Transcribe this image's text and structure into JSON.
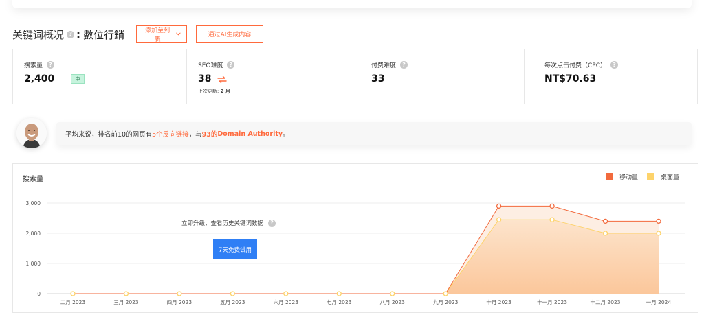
{
  "overview": {
    "title": "关键词概况",
    "separator": ":",
    "keyword": "數位行銷",
    "add_to_list_label": "添加至列表",
    "ai_content_label": "通过AI生成内容"
  },
  "metrics": {
    "search_volume": {
      "label": "搜索量",
      "value": "2,400",
      "badge": "中"
    },
    "seo_difficulty": {
      "label": "SEO难度",
      "value": "38",
      "updated_prefix": "上次更新:",
      "updated_value": "2 月"
    },
    "paid_difficulty": {
      "label": "付费难度",
      "value": "33"
    },
    "cpc": {
      "label": "每次点击付费（CPC）",
      "value": "NT$70.63"
    }
  },
  "insight": {
    "p1": "平均来说，排名前10的网页有",
    "n1": "5个反向链接",
    "p2": "，与",
    "n2": "93的",
    "n3": "Domain Authority",
    "p3": "。"
  },
  "help_glyph": "?",
  "chart_card": {
    "upgrade_text": "立即升级，查看历史关键词数据",
    "trial_button": "7天免费试用"
  },
  "colors": {
    "accent": "#ff6a3d",
    "mobile": "#f26a3d",
    "desktop": "#fdd36b",
    "trial": "#2f7ff5"
  },
  "chart_data": {
    "type": "area",
    "title": "搜索量",
    "categories": [
      "二月 2023",
      "三月 2023",
      "四月 2023",
      "五月 2023",
      "六月 2023",
      "七月 2023",
      "八月 2023",
      "九月 2023",
      "十月 2023",
      "十一月 2023",
      "十二月 2023",
      "一月 2024"
    ],
    "series": [
      {
        "name": "移动量",
        "values": [
          0,
          0,
          0,
          0,
          0,
          0,
          0,
          0,
          2900,
          2900,
          2400,
          2400
        ]
      },
      {
        "name": "桌面量",
        "values": [
          0,
          0,
          0,
          0,
          0,
          0,
          0,
          0,
          2450,
          2450,
          2000,
          2000
        ]
      }
    ],
    "ylim": [
      0,
      3000
    ],
    "yticks": [
      0,
      1000,
      2000,
      3000
    ],
    "ytick_labels": [
      "0",
      "1,000",
      "2,000",
      "3,000"
    ],
    "legend": "top-right",
    "grid": true
  }
}
